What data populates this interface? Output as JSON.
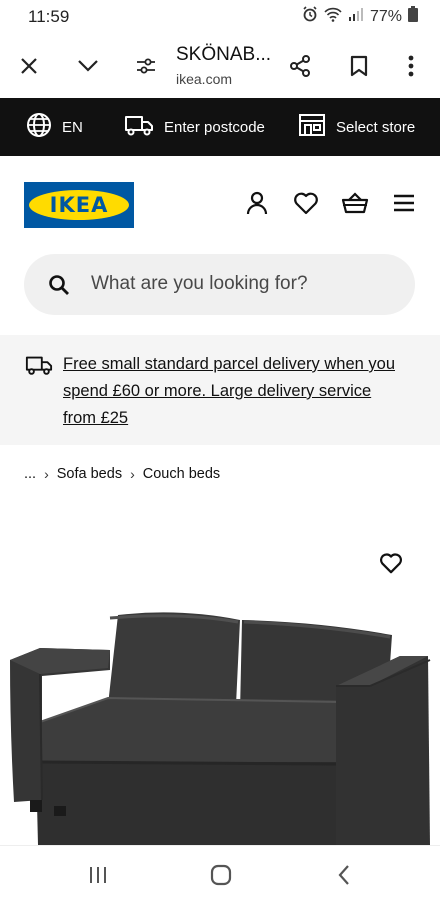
{
  "status_bar": {
    "time": "11:59",
    "battery": "77%"
  },
  "browser": {
    "page_title": "SKÖNAB...",
    "url": "ikea.com"
  },
  "top_strip": {
    "language": "EN",
    "postcode": "Enter postcode",
    "store": "Select store"
  },
  "header": {
    "logo_text": "IKEA"
  },
  "search": {
    "placeholder": "What are you looking for?"
  },
  "delivery": {
    "message": "Free small standard parcel delivery when you spend £60 or more. Large delivery service from £25"
  },
  "breadcrumb": {
    "ellipsis": "...",
    "items": [
      "Sofa beds",
      "Couch beds"
    ]
  },
  "icons": [
    "close-icon",
    "chevron-down-icon",
    "tune-icon",
    "share-icon",
    "bookmark-icon",
    "more-icon",
    "globe-icon",
    "truck-icon",
    "store-icon",
    "user-icon",
    "heart-icon",
    "basket-icon",
    "menu-icon",
    "search-icon"
  ],
  "colors": {
    "brand_blue": "#0058a3",
    "brand_yellow": "#ffdb00",
    "strip": "#111111",
    "search_bg": "#f0f0f0",
    "delivery_bg": "#f5f5f5"
  }
}
